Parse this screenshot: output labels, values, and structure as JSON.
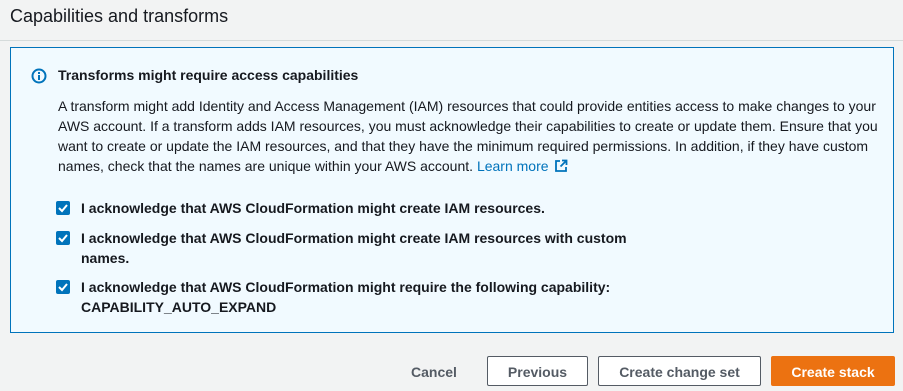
{
  "section": {
    "title": "Capabilities and transforms"
  },
  "info": {
    "icon": "info-icon",
    "title": "Transforms might require access capabilities",
    "body": "A transform might add Identity and Access Management (IAM) resources that could provide entities access to make changes to your AWS account. If a transform adds IAM resources, you must acknowledge their capabilities to create or update them. Ensure that you want to create or update the IAM resources, and that they have the minimum required permissions. In addition, if they have custom names, check that the names are unique within your AWS account.",
    "learn_more": "Learn more",
    "accent_color": "#0073bb"
  },
  "acknowledgements": [
    {
      "label": "I acknowledge that AWS CloudFormation might create IAM resources.",
      "checked": true
    },
    {
      "label": "I acknowledge that AWS CloudFormation might create IAM resources with custom names.",
      "checked": true
    },
    {
      "label": "I acknowledge that AWS CloudFormation might require the following capability: CAPABILITY_AUTO_EXPAND",
      "checked": true
    }
  ],
  "footer": {
    "cancel": "Cancel",
    "previous": "Previous",
    "create_change_set": "Create change set",
    "create_stack": "Create stack",
    "primary_color": "#ec7211"
  }
}
